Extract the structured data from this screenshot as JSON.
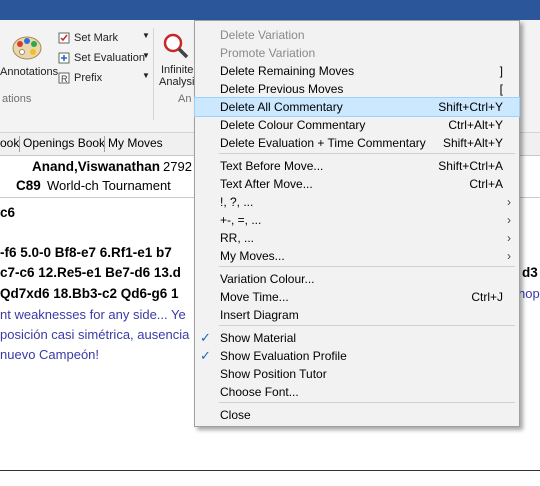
{
  "ribbon": {
    "annotations": "Annotations",
    "set_mark": "Set Mark",
    "set_evaluation": "Set Evaluation",
    "prefix": "Prefix",
    "infinite": "Infinite",
    "analysis": "Analysis",
    "group_annotations": "ations",
    "group_analysis": "An"
  },
  "tabs": [
    "ook",
    "Openings Book",
    "My Moves"
  ],
  "game": {
    "players": "Anand,Viswanathan",
    "rating": "2792",
    "eco": "C89",
    "event": "World-ch Tournament",
    "line1": "c6",
    "line2": "-f6  5.0-0  Bf8-e7  6.Rf1-e1  b7",
    "line3": "c7-c6  12.Re5-e1  Be7-d6  13.d",
    "line4": "Qd7xd6  18.Bb3-c2  Qd6-g6  1",
    "line5": "nt weaknesses for any side... Ye",
    "line6": "posición casi simétrica, ausencia",
    "line7": "nuevo Campeón!",
    "right_d3": "d3",
    "right_hop": "hop"
  },
  "menu": {
    "items": [
      {
        "label": "Delete Variation",
        "shortcut": "",
        "disabled": true
      },
      {
        "label": "Promote Variation",
        "shortcut": "",
        "disabled": true
      },
      {
        "label": "Delete Remaining Moves",
        "shortcut": "]"
      },
      {
        "label": "Delete Previous Moves",
        "shortcut": "["
      },
      {
        "label": "Delete All Commentary",
        "shortcut": "Shift+Ctrl+Y",
        "highlighted": true
      },
      {
        "label": "Delete Colour Commentary",
        "shortcut": "Ctrl+Alt+Y"
      },
      {
        "label": "Delete Evaluation + Time Commentary",
        "shortcut": "Shift+Alt+Y"
      },
      {
        "label": "Text Before Move...",
        "shortcut": "Shift+Ctrl+A"
      },
      {
        "label": "Text After Move...",
        "shortcut": "Ctrl+A"
      },
      {
        "label": "!, ?, ...",
        "submenu": true
      },
      {
        "label": "+-, =, ...",
        "submenu": true
      },
      {
        "label": "RR, ...",
        "submenu": true
      },
      {
        "label": "My Moves...",
        "submenu": true
      },
      {
        "label": "Variation Colour..."
      },
      {
        "label": "Move Time...",
        "shortcut": "Ctrl+J"
      },
      {
        "label": "Insert Diagram"
      },
      {
        "label": "Show Material",
        "checked": true
      },
      {
        "label": "Show Evaluation Profile",
        "checked": true
      },
      {
        "label": "Show Position Tutor"
      },
      {
        "label": "Choose Font..."
      },
      {
        "label": "Close"
      }
    ],
    "submenu_arrow": "›",
    "check_mark": "✓"
  },
  "colors": {
    "accent": "#2b579a",
    "highlight": "#cce8ff",
    "comment_text": "#3a3aa6"
  }
}
